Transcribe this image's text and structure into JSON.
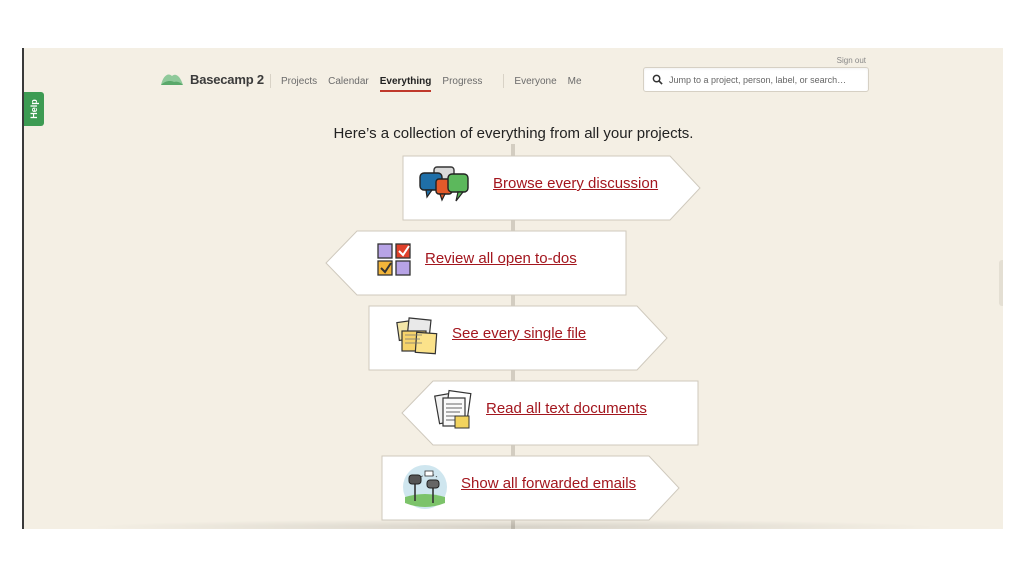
{
  "help": "Help",
  "signout": "Sign out",
  "logo": {
    "text": "Basecamp 2"
  },
  "nav": {
    "projects": "Projects",
    "calendar": "Calendar",
    "everything": "Everything",
    "progress": "Progress",
    "everyone": "Everyone",
    "me": "Me"
  },
  "search": {
    "placeholder": "Jump to a project, person, label, or search…"
  },
  "headline": "Here’s a collection of everything from all your projects.",
  "signs": [
    {
      "label": "Browse every discussion",
      "icon": "speech-bubbles-icon"
    },
    {
      "label": "Review all open to-dos",
      "icon": "todo-checkboxes-icon"
    },
    {
      "label": "See every single file",
      "icon": "files-stack-icon"
    },
    {
      "label": "Read all text documents",
      "icon": "text-documents-icon"
    },
    {
      "label": "Show all forwarded emails",
      "icon": "mailboxes-icon"
    }
  ],
  "colors": {
    "accent": "#c0392b",
    "link": "#a3161e",
    "help": "#3d9b53",
    "background": "#f4efe4"
  }
}
